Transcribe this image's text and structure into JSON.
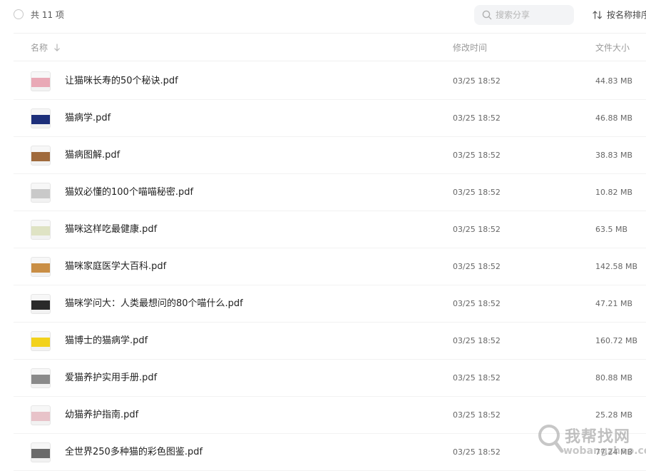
{
  "toolbar": {
    "count_text": "共 11 项",
    "search_placeholder": "搜索分享",
    "sort_label": "按名称排序"
  },
  "columns": {
    "name": "名称",
    "modified": "修改时间",
    "size": "文件大小"
  },
  "files": [
    {
      "name": "让猫咪长寿的50个秘诀.pdf",
      "modified": "03/25 18:52",
      "size": "44.83 MB",
      "thumb_color": "#e9a9b6"
    },
    {
      "name": "猫病学.pdf",
      "modified": "03/25 18:52",
      "size": "46.88 MB",
      "thumb_color": "#1d2f7a"
    },
    {
      "name": "猫病图解.pdf",
      "modified": "03/25 18:52",
      "size": "38.83 MB",
      "thumb_color": "#a06a3c"
    },
    {
      "name": "猫奴必懂的100个喵喵秘密.pdf",
      "modified": "03/25 18:52",
      "size": "10.82 MB",
      "thumb_color": "#c9c9c9"
    },
    {
      "name": "猫咪这样吃最健康.pdf",
      "modified": "03/25 18:52",
      "size": "63.5 MB",
      "thumb_color": "#dfe3c4"
    },
    {
      "name": "猫咪家庭医学大百科.pdf",
      "modified": "03/25 18:52",
      "size": "142.58 MB",
      "thumb_color": "#c98e45"
    },
    {
      "name": "猫咪学问大：人类最想问的80个喵什么.pdf",
      "modified": "03/25 18:52",
      "size": "47.21 MB",
      "thumb_color": "#2a2a2a"
    },
    {
      "name": "猫博士的猫病学.pdf",
      "modified": "03/25 18:52",
      "size": "160.72 MB",
      "thumb_color": "#f2d21c"
    },
    {
      "name": "爱猫养护实用手册.pdf",
      "modified": "03/25 18:52",
      "size": "80.88 MB",
      "thumb_color": "#8a8a8a"
    },
    {
      "name": "幼猫养护指南.pdf",
      "modified": "03/25 18:52",
      "size": "25.28 MB",
      "thumb_color": "#e8c3c9"
    },
    {
      "name": "全世界250多种猫的彩色图鉴.pdf",
      "modified": "03/25 18:52",
      "size": "77.24 MB",
      "thumb_color": "#6b6b6b"
    }
  ],
  "watermark": {
    "text": "我帮找网",
    "url": "wobangzhao.com"
  }
}
